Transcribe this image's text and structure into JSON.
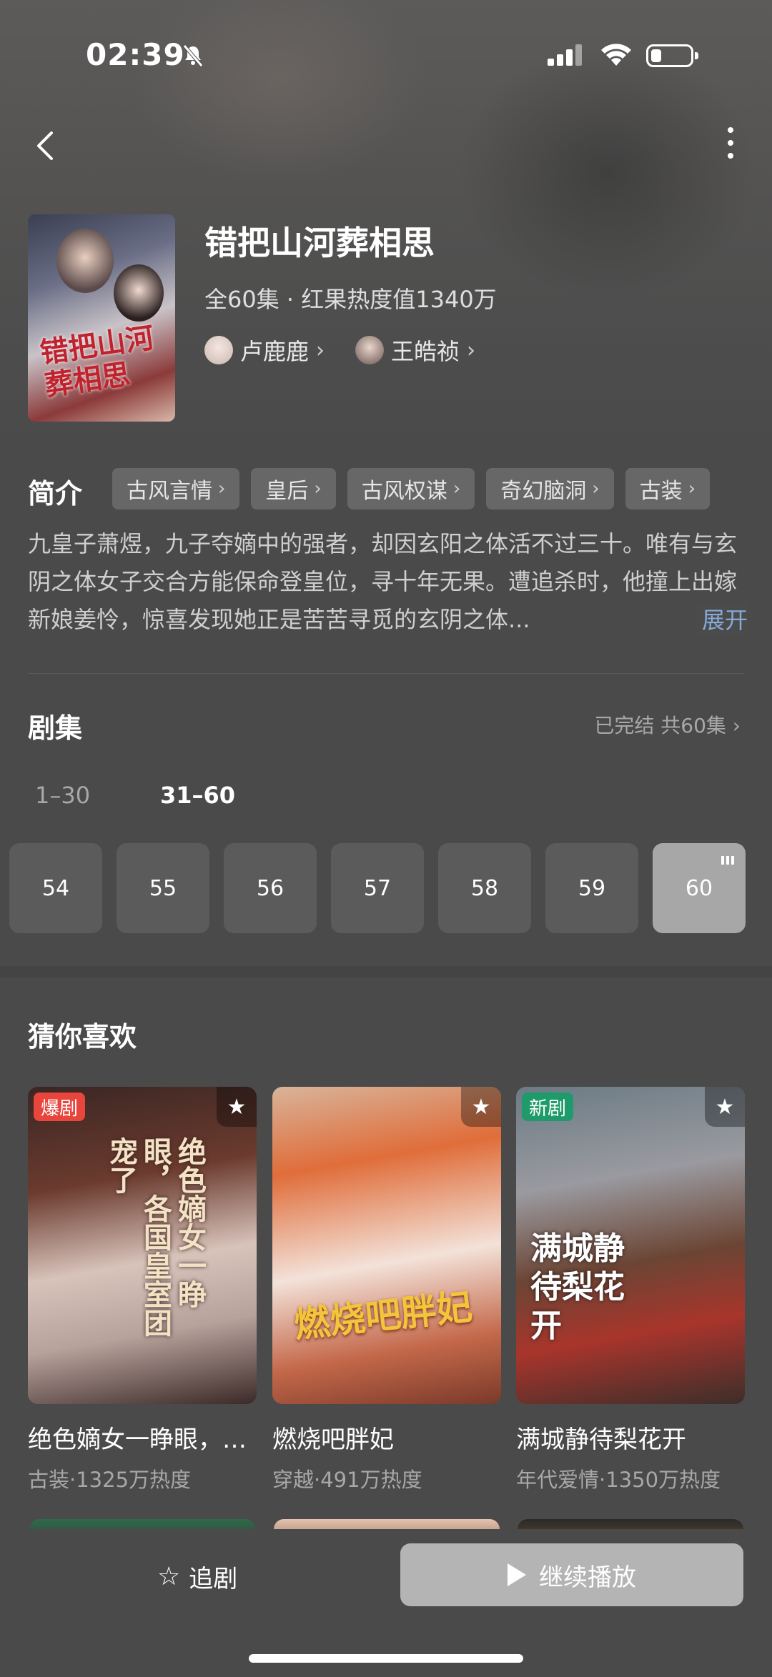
{
  "status_bar": {
    "time": "02:39"
  },
  "drama": {
    "title": "错把山河葬相思",
    "meta": "全60集 · 红果热度值1340万",
    "poster_text": "错把山河葬相思",
    "actors": [
      "卢鹿鹿",
      "王皓祯"
    ]
  },
  "intro": {
    "label": "简介",
    "tags": [
      "古风言情",
      "皇后",
      "古风权谋",
      "奇幻脑洞",
      "古装"
    ],
    "description": "九皇子萧煜，九子夺嫡中的强者，却因玄阳之体活不过三十。唯有与玄阴之体女子交合方能保命登皇位，寻十年无果。遭追杀时，他撞上出嫁新娘姜怜，惊喜发现她正是苦苦寻觅的玄阴之体...",
    "expand_label": "展开"
  },
  "episodes": {
    "label": "剧集",
    "status": "已完结 共60集",
    "ranges": [
      "1–30",
      "31–60"
    ],
    "selected_range": "31–60",
    "items": [
      "54",
      "55",
      "56",
      "57",
      "58",
      "59",
      "60"
    ],
    "current": "60"
  },
  "recommendations": {
    "label": "猜你喜欢",
    "items": [
      {
        "badge": "爆剧",
        "badge_color": "#e8453c",
        "title": "绝色嫡女一睁眼，各国皇室团宠了",
        "poster_text": "绝色嫡女一睁眼，各国皇室团宠了",
        "sub": "古装·1325万热度"
      },
      {
        "badge": "",
        "badge_color": "",
        "title": "燃烧吧胖妃",
        "poster_text": "燃烧吧胖妃",
        "sub": "穿越·491万热度"
      },
      {
        "badge": "新剧",
        "badge_color": "#1f9a6a",
        "title": "满城静待梨花开",
        "poster_text": "满城静待梨花开",
        "sub": "年代爱情·1350万热度"
      }
    ]
  },
  "bottom_bar": {
    "follow_label": "追剧",
    "play_label": "继续播放"
  },
  "colors": {
    "accent_link": "#87a9d7",
    "tag_bg": "#676767",
    "active_episode": "#a7a7a7"
  },
  "icons": [
    "back-arrow-icon",
    "more-vertical-icon",
    "star-icon",
    "play-icon",
    "chevron-right-icon"
  ]
}
